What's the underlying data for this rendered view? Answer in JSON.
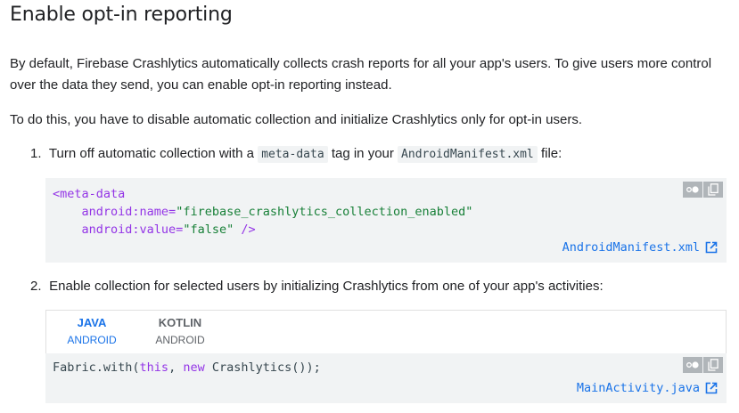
{
  "heading": "Enable opt-in reporting",
  "intro": "By default, Firebase Crashlytics automatically collects crash reports for all your app's users. To give users more control over the data they send, you can enable opt-in reporting instead.",
  "todo": "To do this, you have to disable automatic collection and initialize Crashlytics only for opt-in users.",
  "step1": {
    "number": "1.",
    "text_a": "Turn off automatic collection with a",
    "code_a": "meta-data",
    "text_b": "tag in your",
    "code_b": "AndroidManifest.xml",
    "text_c": "file:"
  },
  "code1": {
    "line1_tag": "<meta-data",
    "line2_attr": "android:name=",
    "line2_val": "\"firebase_crashlytics_collection_enabled\"",
    "line3_attr": "android:value=",
    "line3_val": "\"false\"",
    "line3_end": " />",
    "file": "AndroidManifest.xml"
  },
  "step2": {
    "number": "2.",
    "text": "Enable collection for selected users by initializing Crashlytics from one of your app's activities:"
  },
  "tabs": [
    {
      "label": "JAVA",
      "sub": "ANDROID"
    },
    {
      "label": "KOTLIN",
      "sub": "ANDROID"
    }
  ],
  "code2": {
    "p1": "Fabric.with(",
    "kw_this": "this",
    "p2": ", ",
    "kw_new": "new",
    "p3": " Crashlytics());",
    "file": "MainActivity.java"
  },
  "icons": {
    "dark_mode": "dark-mode-toggle-icon",
    "copy": "copy-icon",
    "open": "open-in-new-icon"
  },
  "colors": {
    "link": "#1a73e8",
    "code_bg": "#f1f3f4",
    "purple": "#9334e6",
    "green": "#188038"
  }
}
